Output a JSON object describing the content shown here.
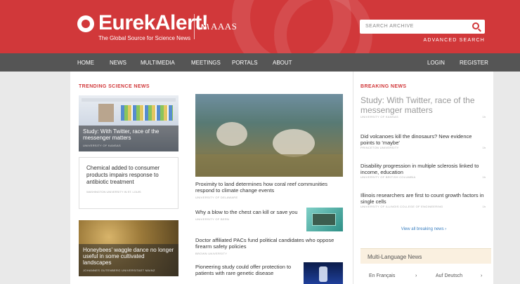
{
  "header": {
    "logo_text": "EurekAlert!",
    "tagline": "The Global Source for Science News",
    "partner": "AAAS",
    "search_placeholder": "SEARCH ARCHIVE",
    "advanced_search": "ADVANCED SEARCH",
    "brand_color": "#d1383a"
  },
  "nav": {
    "items": [
      "HOME",
      "NEWS",
      "MULTIMEDIA",
      "MEETINGS",
      "PORTALS",
      "ABOUT"
    ],
    "login": "LOGIN",
    "register": "REGISTER"
  },
  "trending": {
    "title": "TRENDING SCIENCE NEWS",
    "cards": [
      {
        "title": "Study: With Twitter, race of the messenger matters",
        "source": "UNIVERSITY OF KANSAS"
      },
      {
        "title": "Chemical added to consumer products impairs response to antibiotic treatment",
        "source": "WASHINGTON UNIVERSITY IN ST. LOUIS"
      },
      {
        "title": "Honeybees' waggle dance no longer useful in some cultivated landscapes",
        "source": "JOHANNES GUTENBERG UNIVERSITAET MAINZ"
      }
    ]
  },
  "main": {
    "feature": {
      "title": "Proximity to land determines how coral reef communities respond to climate change events",
      "source": "UNIVERSITY OF DELAWARE"
    },
    "stories": [
      {
        "title": "Why a blow to the chest can kill or save you",
        "source": "UNIVERSITY OF BERN"
      },
      {
        "title": "Doctor affiliated PACs fund political candidates who oppose firearm safety policies",
        "source": "BROWN UNIVERSITY"
      },
      {
        "title": "Pioneering study could offer protection to patients with rare genetic disease",
        "source": ""
      }
    ]
  },
  "breaking": {
    "title": "BREAKING NEWS",
    "items": [
      {
        "title": "Study: With Twitter, race of the messenger matters",
        "source": "UNIVERSITY OF KANSAS",
        "age": "1h"
      },
      {
        "title": "Did volcanoes kill the dinosaurs? New evidence points to 'maybe'",
        "source": "PRINCETON UNIVERSITY",
        "age": "1h"
      },
      {
        "title": "Disability progression in multiple sclerosis linked to income, education",
        "source": "UNIVERSITY OF BRITISH COLUMBIA",
        "age": "1h"
      },
      {
        "title": "Illinois researchers are first to count growth factors in single cells",
        "source": "UNIVERSITY OF ILLINOIS COLLEGE OF ENGINEERING",
        "age": "1h"
      }
    ],
    "view_all": "View all breaking news ›",
    "multi_language": "Multi-Language News",
    "languages": [
      "En Français",
      "Auf Deutsch"
    ]
  }
}
